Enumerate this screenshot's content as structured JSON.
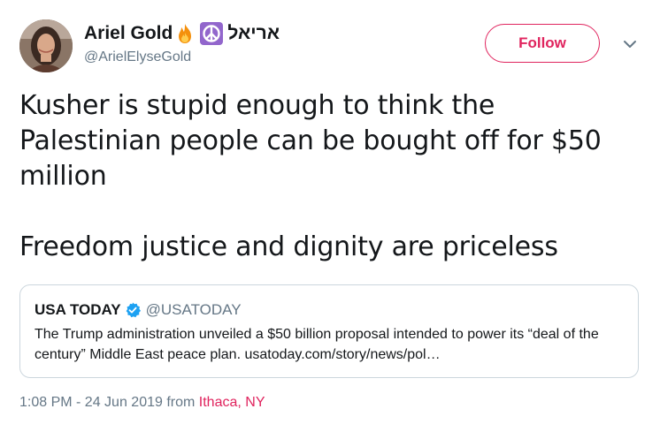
{
  "author": {
    "display_name": "Ariel Gold",
    "hebrew_name": "אריאל",
    "handle": "@ArielElyseGold",
    "emojis": [
      "fire-icon",
      "peace-symbol-icon"
    ]
  },
  "follow_label": "Follow",
  "tweet": {
    "line1": "Kusher is stupid enough to think the Palestinian people can be bought off for $50 million",
    "line2": "Freedom justice and dignity are priceless"
  },
  "quote": {
    "name": "USA TODAY",
    "handle": "@USATODAY",
    "text": "The Trump administration unveiled a $50 billion proposal intended to power its “deal of the century” Middle East peace plan. usatoday.com/story/news/pol…"
  },
  "meta": {
    "timestamp": "1:08 PM - 24 Jun 2019 from ",
    "location": "Ithaca, NY"
  },
  "colors": {
    "accent": "#e0245e",
    "secondary_text": "#657786",
    "verified": "#1da1f2",
    "border": "#ccd6dd"
  }
}
